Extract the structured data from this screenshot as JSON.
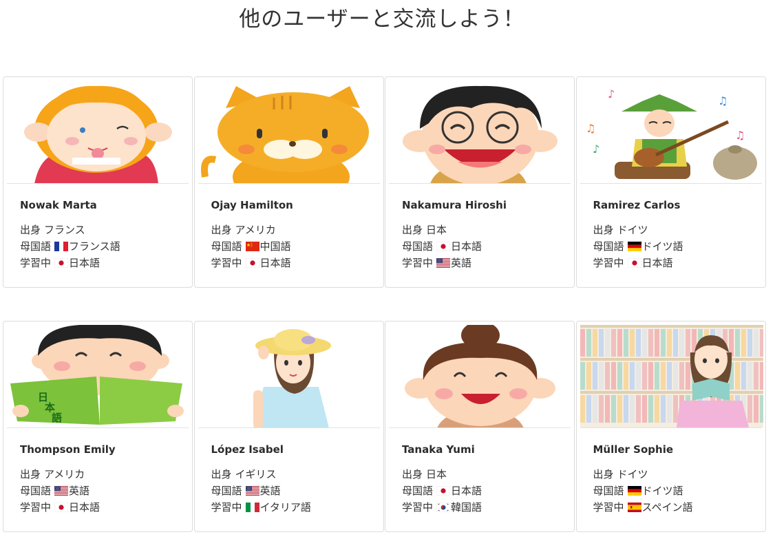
{
  "title": "他のユーザーと交流しよう！",
  "labels": {
    "origin": "出身",
    "native": "母国語",
    "learning": "学習中"
  },
  "users": [
    {
      "name": "Nowak Marta",
      "image_icon": "girl-tongue-out-illustration",
      "origin": "フランス",
      "native": {
        "flag": "fr",
        "lang": "フランス語"
      },
      "learning": {
        "flag": "jp",
        "lang": "日本語"
      }
    },
    {
      "name": "Ojay Hamilton",
      "image_icon": "cat-illustration",
      "origin": "アメリカ",
      "native": {
        "flag": "cn",
        "lang": "中国語"
      },
      "learning": {
        "flag": "jp",
        "lang": "日本語"
      }
    },
    {
      "name": "Nakamura Hiroshi",
      "image_icon": "boy-laughing-illustration",
      "origin": "日本",
      "native": {
        "flag": "jp",
        "lang": "日本語"
      },
      "learning": {
        "flag": "us",
        "lang": "英語"
      }
    },
    {
      "name": "Ramirez Carlos",
      "image_icon": "bard-guitar-illustration",
      "origin": "ドイツ",
      "native": {
        "flag": "de",
        "lang": "ドイツ語"
      },
      "learning": {
        "flag": "jp",
        "lang": "日本語"
      }
    },
    {
      "name": "Thompson Emily",
      "image_icon": "boy-reading-japanese-book-illustration",
      "origin": "アメリカ",
      "native": {
        "flag": "us",
        "lang": "英語"
      },
      "learning": {
        "flag": "jp",
        "lang": "日本語"
      }
    },
    {
      "name": "López Isabel",
      "image_icon": "woman-sunhat-illustration",
      "origin": "イギリス",
      "native": {
        "flag": "us",
        "lang": "英語"
      },
      "learning": {
        "flag": "it",
        "lang": "イタリア語"
      }
    },
    {
      "name": "Tanaka Yumi",
      "image_icon": "woman-laughing-illustration",
      "origin": "日本",
      "native": {
        "flag": "jp",
        "lang": "日本語"
      },
      "learning": {
        "flag": "kr",
        "lang": "韓国語"
      }
    },
    {
      "name": "Müller Sophie",
      "image_icon": "woman-library-reading-illustration",
      "origin": "ドイツ",
      "native": {
        "flag": "de",
        "lang": "ドイツ語"
      },
      "learning": {
        "flag": "es",
        "lang": "スペイン語"
      }
    }
  ]
}
